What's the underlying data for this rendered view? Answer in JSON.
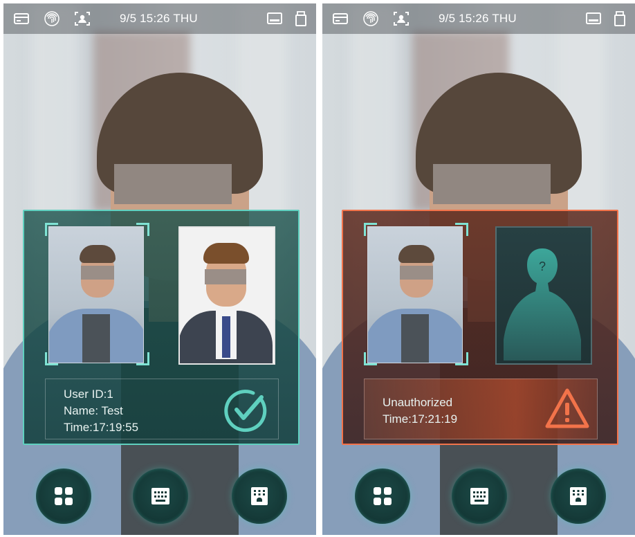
{
  "screens": [
    {
      "status_bar": {
        "datetime": "9/5 15:26  THU"
      },
      "result": {
        "state": "verified",
        "lines": [
          "User ID:1",
          "Name: Test",
          "Time:17:19:55"
        ],
        "accent_color": "#5fd0bf",
        "status_icon": "check-circle-icon"
      }
    },
    {
      "status_bar": {
        "datetime": "9/5 15:26  THU"
      },
      "result": {
        "state": "unauthorized",
        "lines": [
          "Unauthorized",
          "Time:17:21:19"
        ],
        "accent_color": "#f2734a",
        "status_icon": "warning-triangle-icon"
      }
    }
  ],
  "bottom_buttons": [
    "menu-grid-icon",
    "keypad-icon",
    "doorbell-keypad-icon"
  ],
  "status_icons": [
    "card-icon",
    "fingerprint-icon",
    "face-icon",
    "network-icon",
    "usb-icon"
  ]
}
